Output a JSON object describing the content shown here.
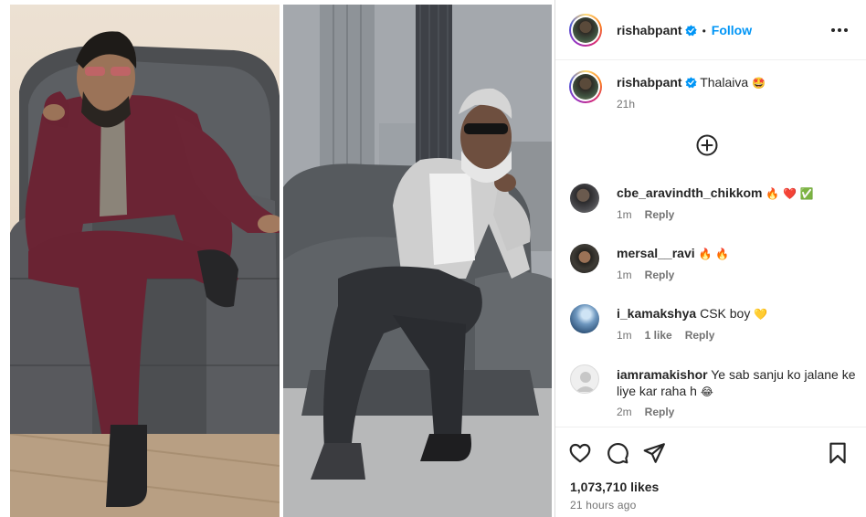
{
  "post": {
    "author": "rishabpant",
    "follow_label": "Follow",
    "separator": "•",
    "caption": "Thalaiva",
    "caption_emoji": "🤩",
    "caption_time": "21h",
    "likes": "1,073,710 likes",
    "posted_ago": "21 hours ago"
  },
  "comments": [
    {
      "username": "cbe_aravindth_chikkom",
      "text": "",
      "emoji": "🔥 ❤️ ✅",
      "time": "1m",
      "likes": "",
      "reply_label": "Reply"
    },
    {
      "username": "mersal__ravi",
      "text": "",
      "emoji": "🔥 🔥",
      "time": "1m",
      "likes": "",
      "reply_label": "Reply"
    },
    {
      "username": "i_kamakshya",
      "text": "CSK boy",
      "emoji": "💛",
      "time": "1m",
      "likes": "1 like",
      "reply_label": "Reply"
    },
    {
      "username": "iamramakishor",
      "text": "Ye sab sanju ko jalane ke",
      "text2": "liye kar raha h",
      "emoji": "😂",
      "time": "2m",
      "likes": "",
      "reply_label": "Reply"
    }
  ],
  "icons": {
    "more": "more-horizontal-icon",
    "add_comment": "plus-circle-icon",
    "like": "heart-icon",
    "comment": "comment-icon",
    "share": "send-icon",
    "save": "bookmark-icon",
    "verified": "verified-badge-icon"
  },
  "colors": {
    "accent": "#0095f6",
    "text": "#262626",
    "muted": "#737373",
    "border": "#dbdbdb",
    "verified": "#0095f6"
  }
}
